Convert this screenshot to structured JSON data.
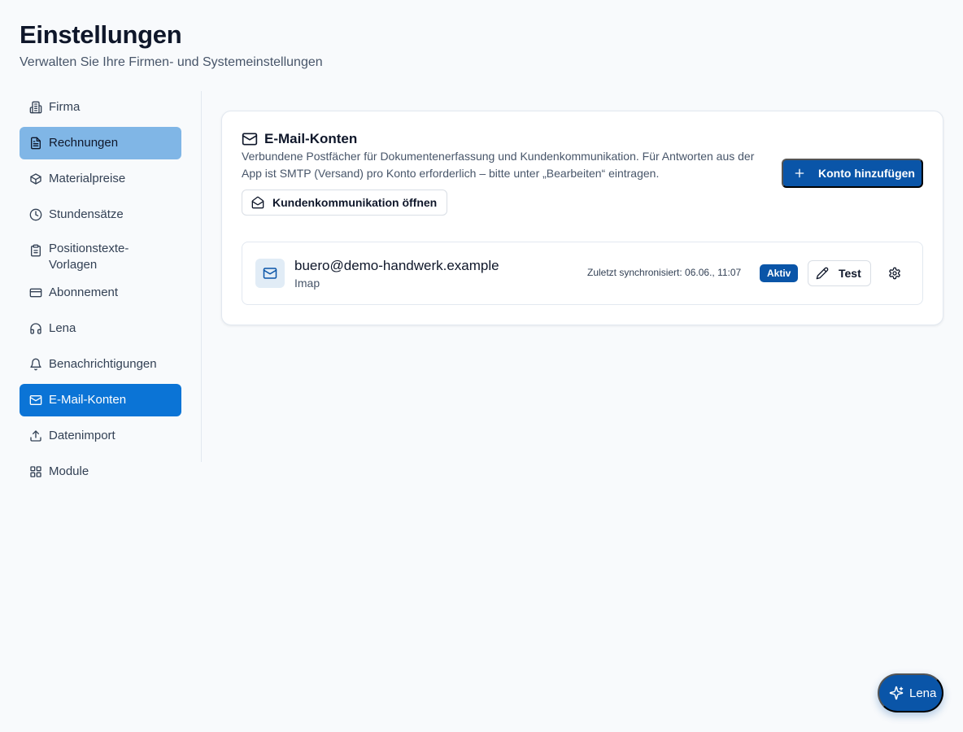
{
  "header": {
    "title": "Einstellungen",
    "subtitle": "Verwalten Sie Ihre Firmen- und Systemeinstellungen"
  },
  "sidebar": {
    "items": [
      {
        "label": "Firma",
        "icon": "building-icon"
      },
      {
        "label": "Rechnungen",
        "icon": "file-text-icon",
        "state": "hover"
      },
      {
        "label": "Materialpreise",
        "icon": "package-icon"
      },
      {
        "label": "Stundensätze",
        "icon": "clock-icon"
      },
      {
        "label": "Positionstexte-Vorlagen",
        "icon": "clipboard-icon"
      },
      {
        "label": "Abonnement",
        "icon": "credit-card-icon"
      },
      {
        "label": "Lena",
        "icon": "headphones-icon"
      },
      {
        "label": "Benachrichtigungen",
        "icon": "bell-icon"
      },
      {
        "label": "E-Mail-Konten",
        "icon": "mail-icon",
        "state": "active"
      },
      {
        "label": "Datenimport",
        "icon": "upload-icon"
      },
      {
        "label": "Module",
        "icon": "grid-icon"
      }
    ]
  },
  "card": {
    "title": "E-Mail-Konten",
    "description": "Verbundene Postfächer für Dokumentenerfassung und Kundenkommunikation. Für Antworten aus der App ist SMTP (Versand) pro Konto erforderlich – bitte unter „Bearbeiten“ eintragen.",
    "open_communication_label": "Kundenkommunikation öffnen",
    "add_account_label": "Konto hinzufügen"
  },
  "accounts": [
    {
      "email": "buero@demo-handwerk.example",
      "type": "Imap",
      "sync": "Zuletzt synchronisiert: 06.06., 11:07",
      "status": "Aktiv",
      "test_label": "Test"
    }
  ],
  "assistant": {
    "label": "Lena"
  },
  "colors": {
    "primary": "#0a55a8",
    "active_nav": "#0b74d6",
    "hover_nav": "#80b6e6",
    "background": "#f8fafc"
  }
}
